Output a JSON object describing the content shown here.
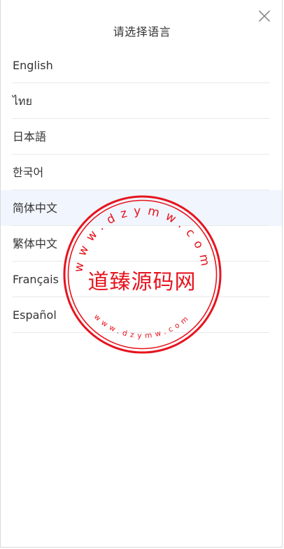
{
  "header": {
    "title": "请选择语言",
    "close_icon": "close-icon"
  },
  "languages": [
    {
      "label": "English",
      "selected": false
    },
    {
      "label": "ไทย",
      "selected": false
    },
    {
      "label": "日本語",
      "selected": false
    },
    {
      "label": "한국어",
      "selected": false
    },
    {
      "label": "简体中文",
      "selected": true
    },
    {
      "label": "繁体中文",
      "selected": false
    },
    {
      "label": "Français",
      "selected": false
    },
    {
      "label": "Español",
      "selected": false
    }
  ],
  "watermark": {
    "name": "道臻源码网",
    "outer_ring": "www.dzymw.com",
    "inner_ring": "www.dzymw.com",
    "color": "#e6141e"
  },
  "colors": {
    "selected_bg": "#f1f5fd",
    "divider": "#e8e8e8",
    "text": "#333333"
  }
}
